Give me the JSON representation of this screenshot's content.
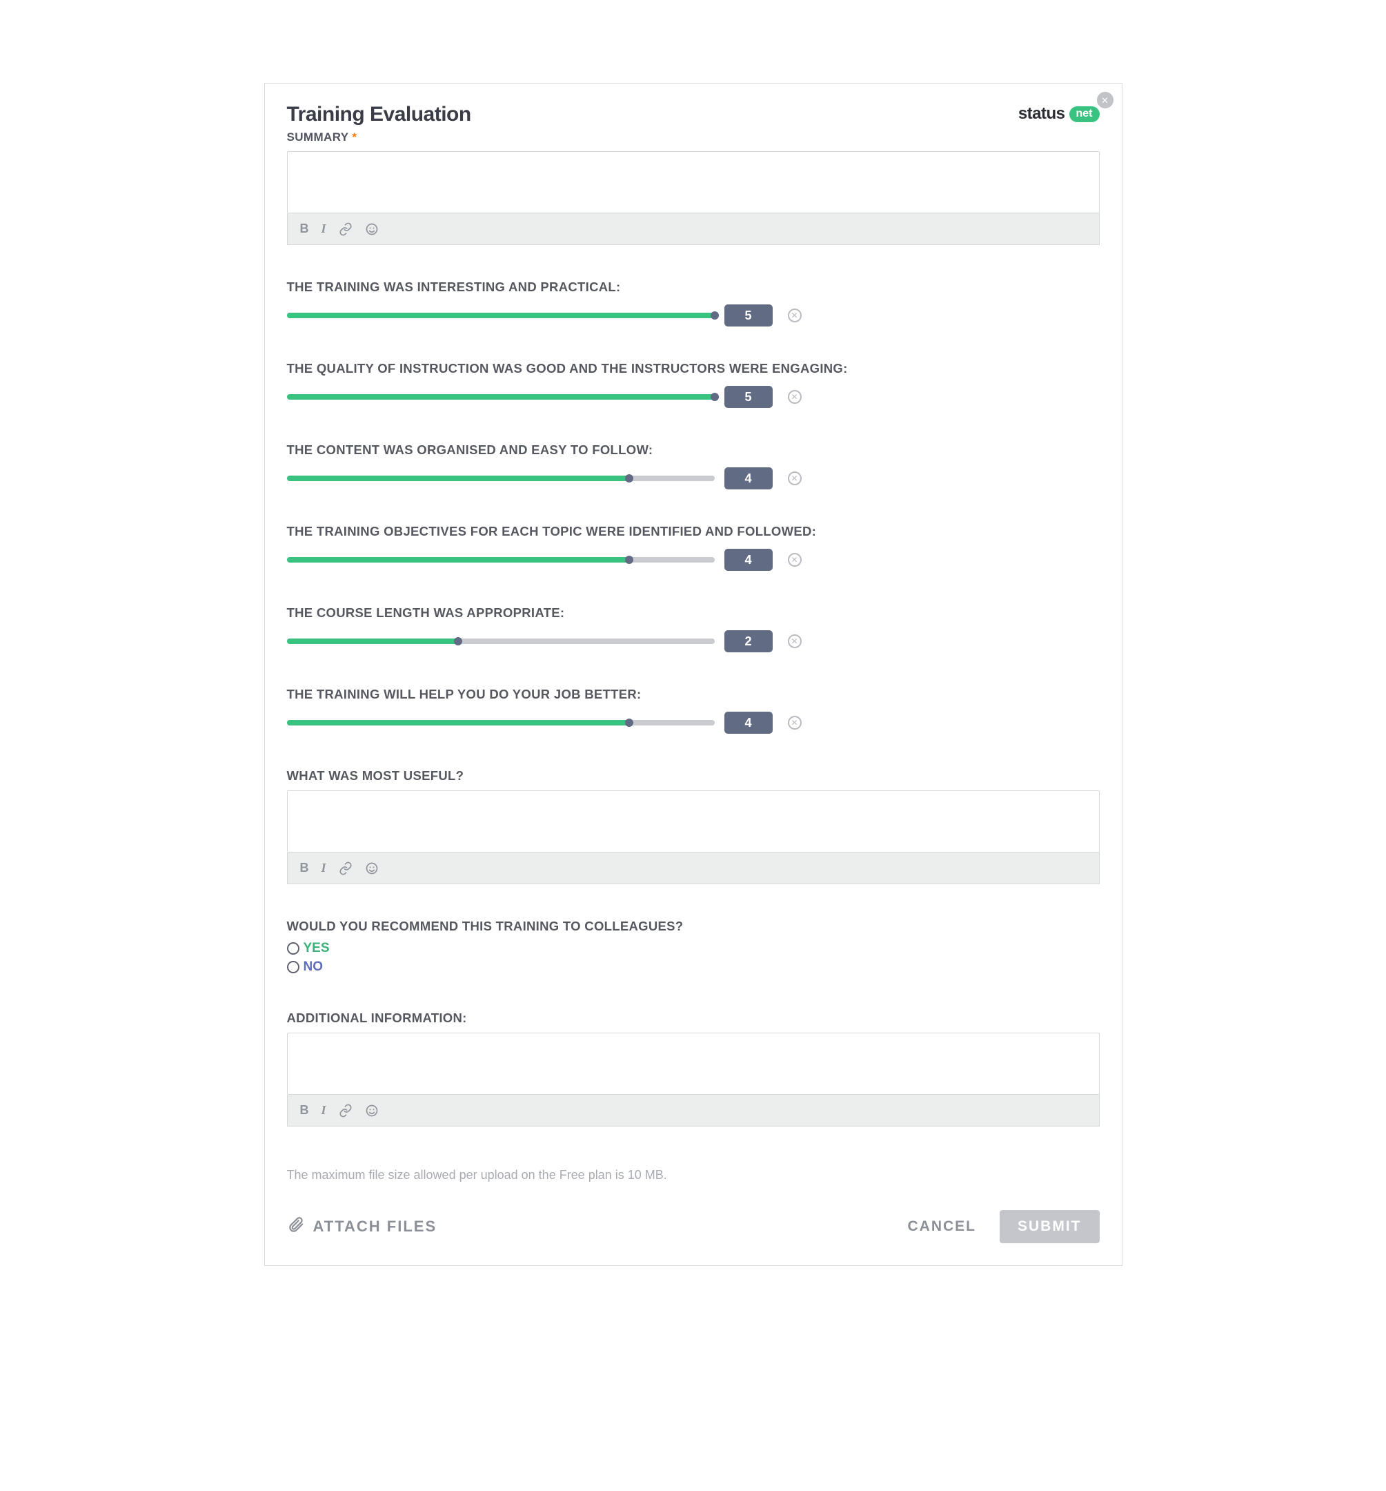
{
  "title": "Training Evaluation",
  "logo": {
    "text": "status",
    "pill": "net"
  },
  "summary": {
    "label": "SUMMARY",
    "required_mark": "*"
  },
  "sliders": {
    "max": 5,
    "items": [
      {
        "label": "THE TRAINING WAS INTERESTING AND PRACTICAL:",
        "value": 5
      },
      {
        "label": "THE QUALITY OF INSTRUCTION WAS GOOD AND THE INSTRUCTORS WERE ENGAGING:",
        "value": 5
      },
      {
        "label": "THE CONTENT WAS ORGANISED AND EASY TO FOLLOW:",
        "value": 4
      },
      {
        "label": "THE TRAINING OBJECTIVES FOR EACH TOPIC WERE IDENTIFIED AND FOLLOWED:",
        "value": 4
      },
      {
        "label": "THE COURSE LENGTH WAS APPROPRIATE:",
        "value": 2
      },
      {
        "label": "THE TRAINING WILL HELP YOU DO YOUR JOB BETTER:",
        "value": 4
      }
    ]
  },
  "useful_q": {
    "label": "WHAT WAS MOST USEFUL?"
  },
  "recommend_q": {
    "label": "WOULD YOU RECOMMEND THIS TRAINING TO COLLEAGUES?",
    "yes": "YES",
    "no": "NO"
  },
  "additional_q": {
    "label": "ADDITIONAL INFORMATION:"
  },
  "file_note": "The maximum file size allowed per upload on the Free plan is 10 MB.",
  "footer": {
    "attach": "ATTACH FILES",
    "cancel": "CANCEL",
    "submit": "SUBMIT"
  }
}
